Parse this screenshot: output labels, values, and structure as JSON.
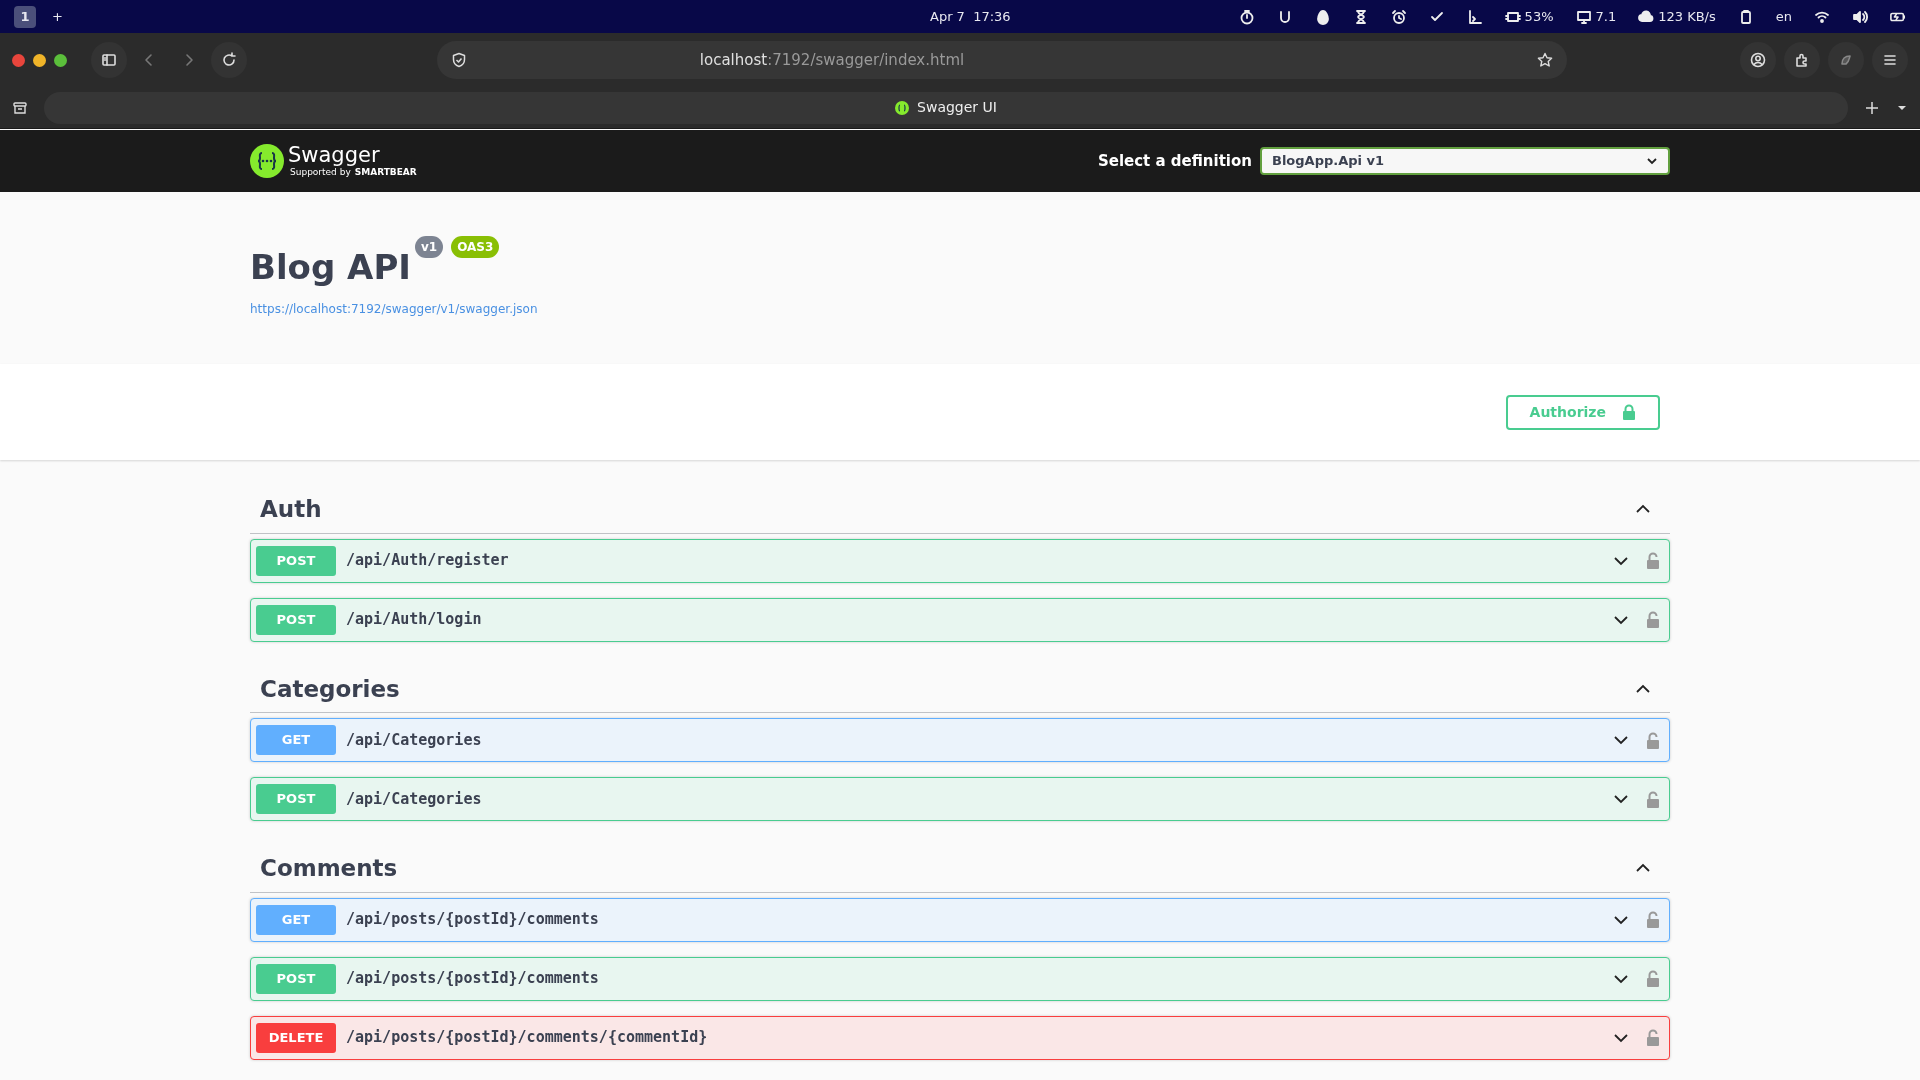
{
  "system_bar": {
    "workspace": "1",
    "add": "+",
    "clock": "Apr 7  17:36",
    "cpu": "53%",
    "load": "7.1",
    "network": "123 KB/s",
    "language": "en"
  },
  "browser": {
    "url_host": "localhost",
    "url_path": ":7192/swagger/index.html",
    "tab_title": "Swagger UI"
  },
  "swagger_header": {
    "logo_text": "Swagger",
    "logo_sub": "Supported by",
    "logo_brand": "SMARTBEAR",
    "definition_label": "Select a definition",
    "definition_value": "BlogApp.Api v1"
  },
  "info": {
    "title": "Blog API",
    "version": "v1",
    "spec": "OAS3",
    "url": "https://localhost:7192/swagger/v1/swagger.json"
  },
  "authorize": "Authorize",
  "sections": [
    {
      "name": "Auth",
      "expanded": true,
      "operations": [
        {
          "method": "POST",
          "kind": "post",
          "path": "/api/Auth/register",
          "expanded": false
        },
        {
          "method": "POST",
          "kind": "post",
          "path": "/api/Auth/login",
          "expanded": false
        }
      ]
    },
    {
      "name": "Categories",
      "expanded": true,
      "operations": [
        {
          "method": "GET",
          "kind": "get",
          "path": "/api/Categories",
          "expanded": false
        },
        {
          "method": "POST",
          "kind": "post",
          "path": "/api/Categories",
          "expanded": false
        }
      ]
    },
    {
      "name": "Comments",
      "expanded": true,
      "operations": [
        {
          "method": "GET",
          "kind": "get",
          "path": "/api/posts/{postId}/comments",
          "expanded": false
        },
        {
          "method": "POST",
          "kind": "post",
          "path": "/api/posts/{postId}/comments",
          "expanded": false
        },
        {
          "method": "DELETE",
          "kind": "delete",
          "path": "/api/posts/{postId}/comments/{commentId}",
          "expanded": false
        }
      ]
    }
  ]
}
